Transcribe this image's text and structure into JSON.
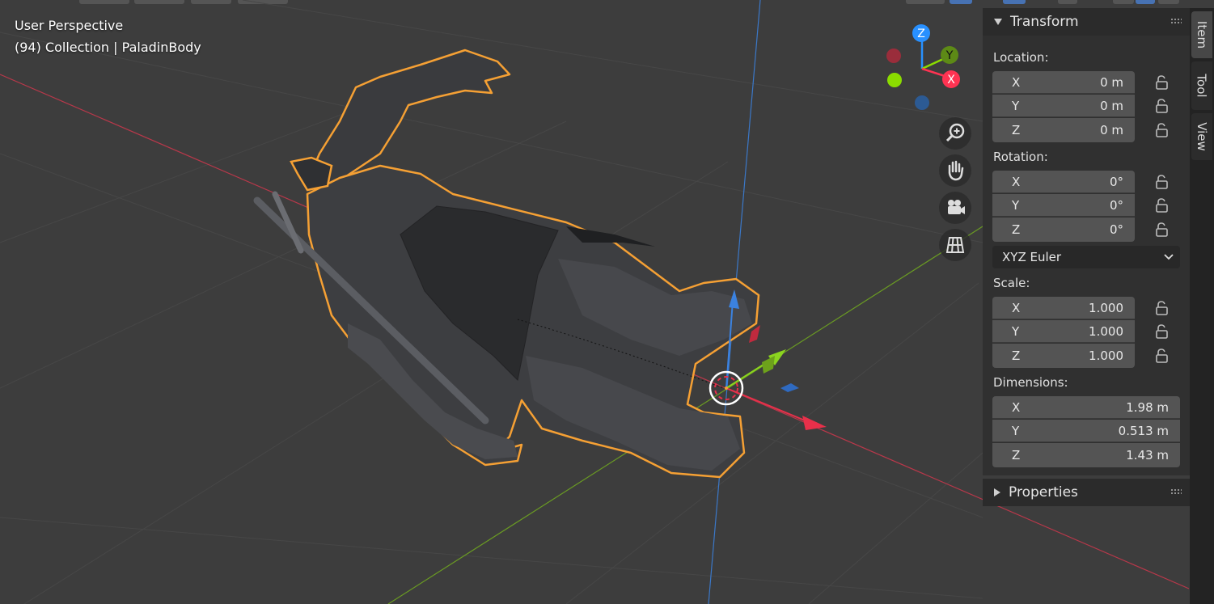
{
  "viewport": {
    "title": "User Perspective",
    "subtitle": "(94) Collection | PaladinBody",
    "selected_object": "PaladinBody"
  },
  "gizmo": {
    "axes": {
      "x": "X",
      "y": "Y",
      "z": "Z"
    },
    "colors": {
      "x": "#ff3352",
      "y": "#8bdc00",
      "z": "#2890ff",
      "x_neg": "#9a2d3b",
      "y_neg": "#5d8a16",
      "z_neg": "#2c5a93"
    }
  },
  "nav_tools": [
    {
      "name": "zoom-icon"
    },
    {
      "name": "pan-hand-icon"
    },
    {
      "name": "camera-icon"
    },
    {
      "name": "grid-ortho-icon"
    }
  ],
  "npanel": {
    "transform": {
      "header": "Transform",
      "location": {
        "label": "Location:",
        "x": {
          "axis": "X",
          "value": "0 m"
        },
        "y": {
          "axis": "Y",
          "value": "0 m"
        },
        "z": {
          "axis": "Z",
          "value": "0 m"
        }
      },
      "rotation": {
        "label": "Rotation:",
        "x": {
          "axis": "X",
          "value": "0°"
        },
        "y": {
          "axis": "Y",
          "value": "0°"
        },
        "z": {
          "axis": "Z",
          "value": "0°"
        },
        "mode": "XYZ Euler"
      },
      "scale": {
        "label": "Scale:",
        "x": {
          "axis": "X",
          "value": "1.000"
        },
        "y": {
          "axis": "Y",
          "value": "1.000"
        },
        "z": {
          "axis": "Z",
          "value": "1.000"
        }
      },
      "dimensions": {
        "label": "Dimensions:",
        "x": {
          "axis": "X",
          "value": "1.98 m"
        },
        "y": {
          "axis": "Y",
          "value": "0.513 m"
        },
        "z": {
          "axis": "Z",
          "value": "1.43 m"
        }
      }
    },
    "properties": {
      "header": "Properties"
    }
  },
  "tabs": [
    {
      "label": "Item",
      "active": true
    },
    {
      "label": "Tool",
      "active": false
    },
    {
      "label": "View",
      "active": false
    }
  ],
  "colors": {
    "selection_outline": "#f5a034",
    "axis_x_line": "#b8384a",
    "axis_y_line": "#6a9b23",
    "axis_z_line": "#3b78c8"
  }
}
